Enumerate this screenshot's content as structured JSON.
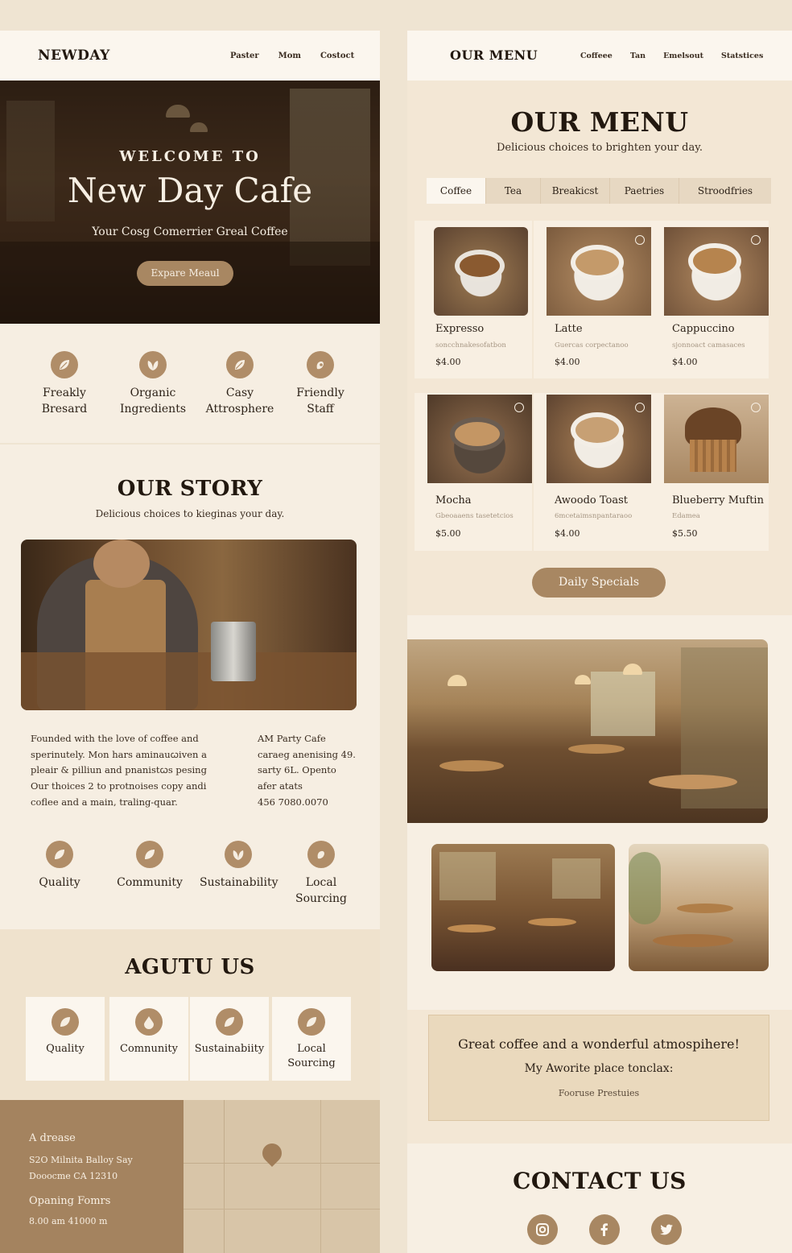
{
  "home": {
    "brand": "NEWDAY",
    "nav": [
      "Paster",
      "Mom",
      "Costoct"
    ],
    "hero": {
      "welcome": "WELCOME TO",
      "title": "New Day Cafe",
      "subtitle": "Your Cosg Comerrier Greal Coffee",
      "button": "Expare Meaul"
    },
    "features": [
      {
        "icon": "leaf-icon",
        "line1": "Freakly",
        "line2": "Bresard"
      },
      {
        "icon": "sprout-icon",
        "line1": "Organic",
        "line2": "Ingredients"
      },
      {
        "icon": "leaf-icon",
        "line1": "Casy",
        "line2": "Attrosphere"
      },
      {
        "icon": "hand-icon",
        "line1": "Friendly",
        "line2": "Staff"
      }
    ],
    "story": {
      "title": "OUR STORY",
      "subtitle": "Delicious choices to kieginas your day.",
      "paragraph": [
        "Founded with the love of coffee and",
        "sperinutely. Mon hars aminauꞷiven a",
        "pleair & pilliun and pnanistꞷs pesing",
        "Our thoices 2 to protnoises copy andi",
        "coflee and a main, traling-quar."
      ],
      "info": [
        "AM Party Cafe",
        "caraeg anenising 49.",
        "sarty 6L. Opento",
        "afer atats",
        "456 7080.0070"
      ]
    },
    "values": [
      {
        "icon": "leaf-icon",
        "line1": "Quality",
        "line2": ""
      },
      {
        "icon": "leaf-icon",
        "line1": "Community",
        "line2": ""
      },
      {
        "icon": "sprout-icon",
        "line1": "Sustainability",
        "line2": ""
      },
      {
        "icon": "hand-icon",
        "line1": "Local",
        "line2": "Sourcing"
      }
    ],
    "about": {
      "title": "AGUTU US",
      "cards": [
        {
          "icon": "leaf-icon",
          "line1": "Quality",
          "line2": ""
        },
        {
          "icon": "drop-icon",
          "line1": "Comnunity",
          "line2": ""
        },
        {
          "icon": "leaf-icon",
          "line1": "Sustainabiity",
          "line2": ""
        },
        {
          "icon": "leaf-icon",
          "line1": "Local",
          "line2": "Sourcing"
        }
      ]
    },
    "footer": {
      "address_label": "A drease",
      "address1": "S2O Milnita Balloy Say",
      "address2": "Dooocme CA 12310",
      "hours_label": "Opaning Fomrs",
      "hours": "8.00 am  41000 m"
    }
  },
  "menu": {
    "header": "OUR MENU",
    "nav": [
      "Coffeee",
      "Tan",
      "Emelsout",
      "Statstices"
    ],
    "title": "OUR MENU",
    "subtitle": "Delicious choices to brighten your day.",
    "tabs": [
      "Coffee",
      "Tea",
      "Breakicst",
      "Paetries",
      "Stroodfries"
    ],
    "active_tab": "Coffee",
    "items": [
      {
        "name": "Expresso",
        "desc": "soncchnakesofatbon",
        "price": "$4.00"
      },
      {
        "name": "Latte",
        "desc": "Guercas corpectanoo",
        "price": "$4.00"
      },
      {
        "name": "Cappuccino",
        "desc": "sjonnoact camasaces",
        "price": "$4.00"
      },
      {
        "name": "Mocha",
        "desc": "Gbeoaaens tasetetcios",
        "price": "$5.00"
      },
      {
        "name": "Awoodo Toast",
        "desc": "6mcetaimsnpantaraoo",
        "price": "$4.00"
      },
      {
        "name": "Blueberry Muftin",
        "desc": "Edamea",
        "price": "$5.50"
      }
    ],
    "daily_button": "Daily Specials",
    "review": {
      "line1": "Great coffee and a wonderful atmospihere!",
      "line2": "My Aworite place tonclax:",
      "author": "Fooruse Prestuies"
    },
    "contact_title": "CONTACT US",
    "social": [
      "instagram-icon",
      "facebook-icon",
      "twitter-icon"
    ]
  },
  "colors": {
    "accent": "#a88762",
    "background": "#f6eee2",
    "text": "#22180f"
  }
}
